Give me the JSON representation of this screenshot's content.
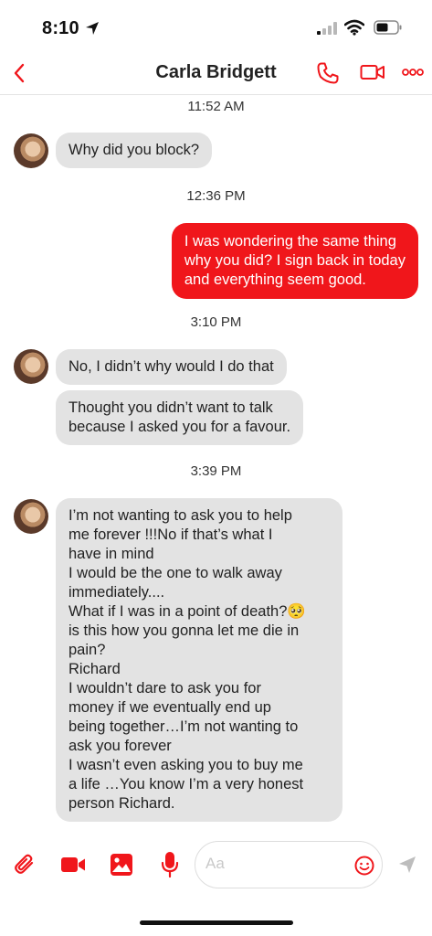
{
  "status_bar": {
    "time": "8:10",
    "icons": [
      "location-arrow-icon",
      "signal-icon",
      "wifi-icon",
      "battery-icon"
    ]
  },
  "header": {
    "contact_name": "Carla Bridgett",
    "icons": [
      "back-icon",
      "phone-icon",
      "video-icon",
      "more-icon"
    ],
    "accent_color": "#f0161b"
  },
  "messages": {
    "timestamps": [
      "11:52 AM",
      "12:36 PM",
      "3:10 PM",
      "3:39 PM"
    ],
    "m1": {
      "sender": "incoming",
      "lines": [
        "Why did you block?"
      ]
    },
    "m2": {
      "sender": "outgoing",
      "lines": [
        "I was wondering the same thing",
        "why you did? I sign back in today",
        "and everything seem good."
      ]
    },
    "m3": {
      "sender": "incoming",
      "lines": [
        "No, I didn’t why would I do that"
      ]
    },
    "m4": {
      "sender": "incoming",
      "lines": [
        "Thought you didn’t want to talk",
        "because I asked you for a favour."
      ]
    },
    "m5": {
      "sender": "incoming",
      "lines": [
        "I’m not wanting to ask you to help",
        "me forever !!!No if that’s what I",
        "have in mind",
        "I would be the one to walk away",
        "immediately....",
        "What if I was in a point of death?🥺",
        "is this how you gonna let me die in",
        "pain?",
        "Richard",
        "I wouldn’t dare to ask you for",
        "money if we eventually end up",
        "being together…I’m not wanting to",
        "ask you forever",
        "I wasn’t even asking you to buy me",
        "a life …You know I’m a very honest",
        "person Richard."
      ]
    },
    "incoming_bubble_color": "#e3e3e3",
    "outgoing_bubble_color": "#f0161b"
  },
  "composer": {
    "placeholder": "Aa",
    "icons": [
      "paperclip-icon",
      "camera-icon",
      "image-icon",
      "microphone-icon",
      "emoji-icon",
      "send-icon"
    ]
  }
}
